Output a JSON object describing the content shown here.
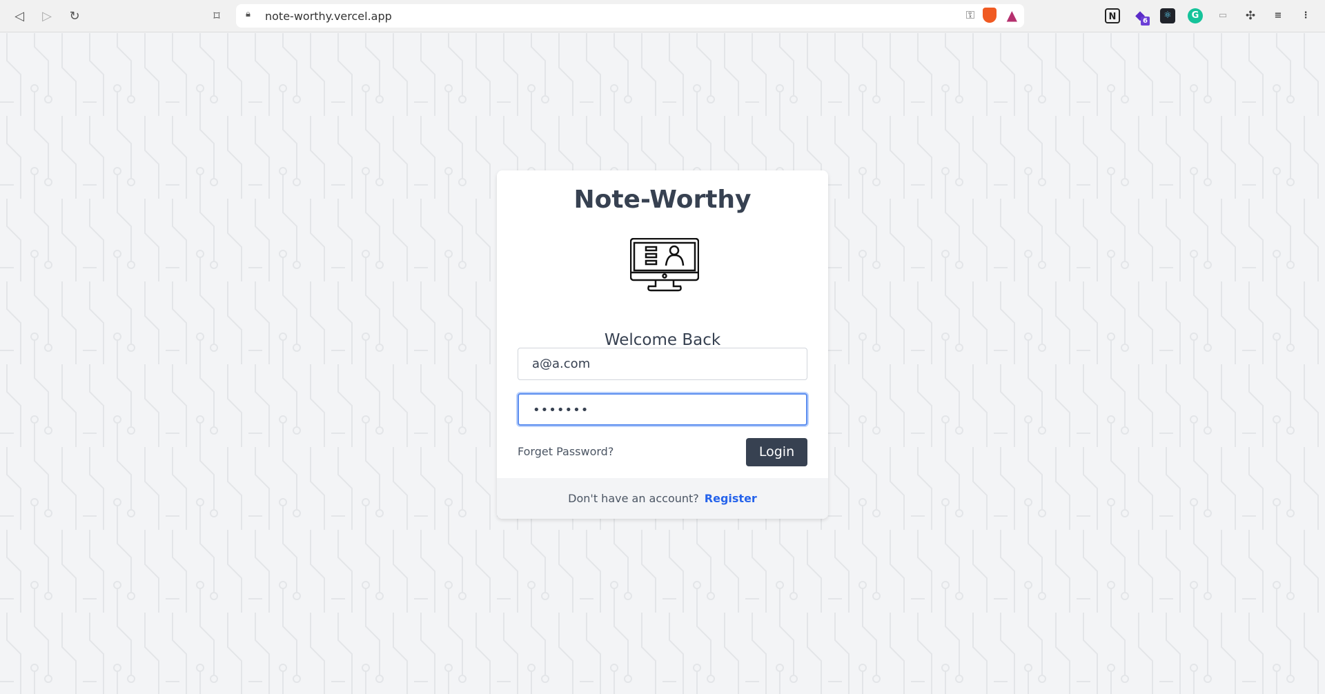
{
  "browser": {
    "url": "note-worthy.vercel.app",
    "extension_badge": "6"
  },
  "app": {
    "title": "Note-Worthy",
    "subtitle": "Welcome Back"
  },
  "form": {
    "email_value": "a@a.com",
    "password_value": "•••••••",
    "forget_label": "Forget Password?",
    "login_label": "Login"
  },
  "footer": {
    "prompt": "Don't have an account?",
    "register_label": "Register"
  },
  "colors": {
    "primary": "#374151",
    "link": "#2563eb",
    "focus": "#5b8def"
  }
}
